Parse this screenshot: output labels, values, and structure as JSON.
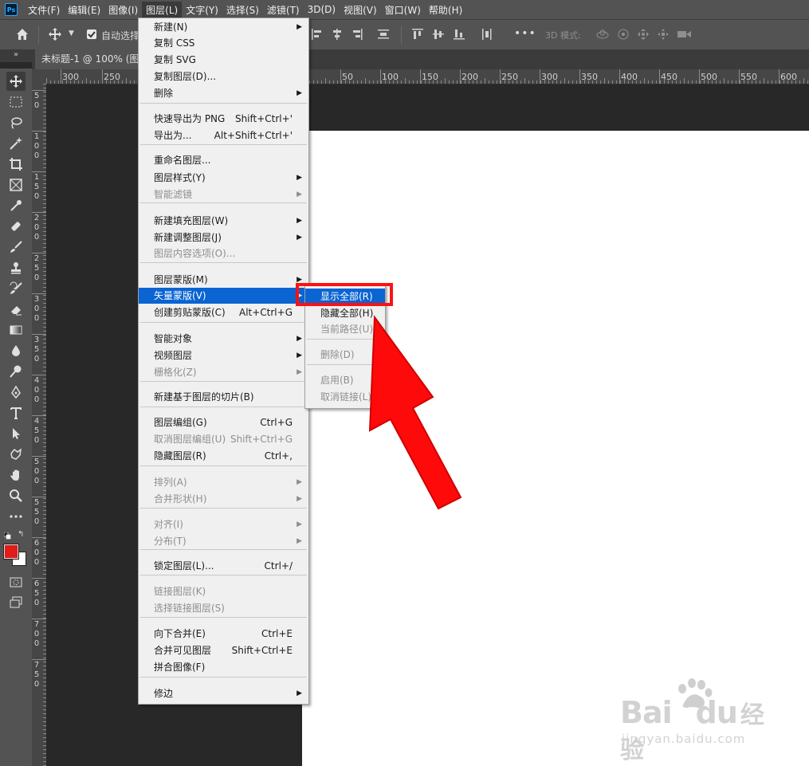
{
  "app": {
    "logo": "Ps"
  },
  "menubar": [
    "文件(F)",
    "编辑(E)",
    "图像(I)",
    "图层(L)",
    "文字(Y)",
    "选择(S)",
    "滤镜(T)",
    "3D(D)",
    "视图(V)",
    "窗口(W)",
    "帮助(H)"
  ],
  "optionsbar": {
    "auto_select": "自动选择",
    "three_d_mode": "3D 模式:",
    "more": "•••"
  },
  "panel_collapse": "»",
  "doc_tab": "未标题-1 @ 100% (图层",
  "hruler": [
    "300",
    "250",
    "50",
    "100",
    "150",
    "200",
    "250",
    "300",
    "350",
    "400",
    "450",
    "500",
    "550",
    "600"
  ],
  "vruler": [
    "50",
    "100",
    "150",
    "200",
    "250",
    "300",
    "350",
    "400",
    "450",
    "500",
    "550",
    "600",
    "650",
    "700",
    "750"
  ],
  "layer_menu": [
    {
      "label": "新建(N)",
      "shortcut": "",
      "submenu": true,
      "disabled": false
    },
    {
      "label": "复制 CSS",
      "shortcut": "",
      "submenu": false,
      "disabled": false
    },
    {
      "label": "复制 SVG",
      "shortcut": "",
      "submenu": false,
      "disabled": false
    },
    {
      "label": "复制图层(D)...",
      "shortcut": "",
      "submenu": false,
      "disabled": false
    },
    {
      "label": "删除",
      "shortcut": "",
      "submenu": true,
      "disabled": false
    },
    {
      "label": "快速导出为 PNG",
      "shortcut": "Shift+Ctrl+'",
      "submenu": false,
      "disabled": false
    },
    {
      "label": "导出为...",
      "shortcut": "Alt+Shift+Ctrl+'",
      "submenu": false,
      "disabled": false
    },
    {
      "label": "重命名图层...",
      "shortcut": "",
      "submenu": false,
      "disabled": false
    },
    {
      "label": "图层样式(Y)",
      "shortcut": "",
      "submenu": true,
      "disabled": false
    },
    {
      "label": "智能滤镜",
      "shortcut": "",
      "submenu": true,
      "disabled": true
    },
    {
      "label": "新建填充图层(W)",
      "shortcut": "",
      "submenu": true,
      "disabled": false
    },
    {
      "label": "新建调整图层(J)",
      "shortcut": "",
      "submenu": true,
      "disabled": false
    },
    {
      "label": "图层内容选项(O)...",
      "shortcut": "",
      "submenu": false,
      "disabled": true
    },
    {
      "label": "图层蒙版(M)",
      "shortcut": "",
      "submenu": true,
      "disabled": false
    },
    {
      "label": "矢量蒙版(V)",
      "shortcut": "",
      "submenu": true,
      "disabled": false,
      "highlighted": true
    },
    {
      "label": "创建剪贴蒙版(C)",
      "shortcut": "Alt+Ctrl+G",
      "submenu": false,
      "disabled": false
    },
    {
      "label": "智能对象",
      "shortcut": "",
      "submenu": true,
      "disabled": false
    },
    {
      "label": "视频图层",
      "shortcut": "",
      "submenu": true,
      "disabled": false
    },
    {
      "label": "栅格化(Z)",
      "shortcut": "",
      "submenu": true,
      "disabled": true
    },
    {
      "label": "新建基于图层的切片(B)",
      "shortcut": "",
      "submenu": false,
      "disabled": false
    },
    {
      "label": "图层编组(G)",
      "shortcut": "Ctrl+G",
      "submenu": false,
      "disabled": false
    },
    {
      "label": "取消图层编组(U)",
      "shortcut": "Shift+Ctrl+G",
      "submenu": false,
      "disabled": true
    },
    {
      "label": "隐藏图层(R)",
      "shortcut": "Ctrl+,",
      "submenu": false,
      "disabled": false
    },
    {
      "label": "排列(A)",
      "shortcut": "",
      "submenu": true,
      "disabled": true
    },
    {
      "label": "合并形状(H)",
      "shortcut": "",
      "submenu": true,
      "disabled": true
    },
    {
      "label": "对齐(I)",
      "shortcut": "",
      "submenu": true,
      "disabled": true
    },
    {
      "label": "分布(T)",
      "shortcut": "",
      "submenu": true,
      "disabled": true
    },
    {
      "label": "锁定图层(L)...",
      "shortcut": "Ctrl+/",
      "submenu": false,
      "disabled": false
    },
    {
      "label": "链接图层(K)",
      "shortcut": "",
      "submenu": false,
      "disabled": true
    },
    {
      "label": "选择链接图层(S)",
      "shortcut": "",
      "submenu": false,
      "disabled": true
    },
    {
      "label": "向下合并(E)",
      "shortcut": "Ctrl+E",
      "submenu": false,
      "disabled": false
    },
    {
      "label": "合并可见图层",
      "shortcut": "Shift+Ctrl+E",
      "submenu": false,
      "disabled": false
    },
    {
      "label": "拼合图像(F)",
      "shortcut": "",
      "submenu": false,
      "disabled": false
    },
    {
      "label": "修边",
      "shortcut": "",
      "submenu": true,
      "disabled": false
    }
  ],
  "vector_mask_menu": [
    {
      "label": "显示全部(R)",
      "disabled": false,
      "highlighted": true
    },
    {
      "label": "隐藏全部(H)",
      "disabled": false
    },
    {
      "label": "当前路径(U)",
      "disabled": true
    },
    {
      "label": "删除(D)",
      "disabled": true
    },
    {
      "label": "启用(B)",
      "disabled": true
    },
    {
      "label": "取消链接(L)",
      "disabled": true
    }
  ],
  "watermark": {
    "brand": "Bai",
    "brand2": "du",
    "product": "经验",
    "url": "jingyan.baidu.com"
  },
  "colors": {
    "foreground": "#e21b1b",
    "background": "#ffffff",
    "highlight": "#0a64d2",
    "annotation": "#ff1010"
  }
}
